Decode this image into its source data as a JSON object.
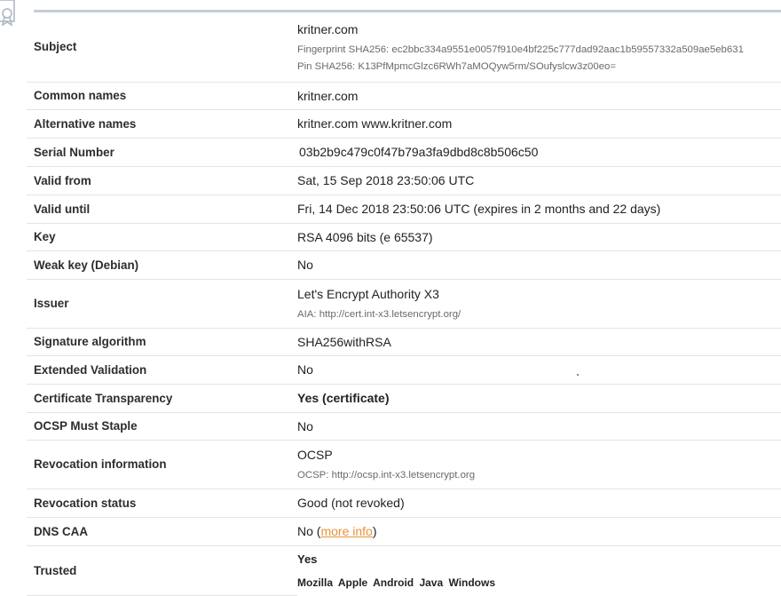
{
  "rows": [
    {
      "label": "Subject",
      "value": "kritner.com",
      "sub1": "Fingerprint SHA256: ec2bbc334a9551e0057f910e4bf225c777dad92aac1b59557332a509ae5eb631",
      "sub2": "Pin SHA256: K13PfMpmcGlzc6RWh7aMOQyw5rm/SOufyslcw3z00eo="
    },
    {
      "label": "Common names",
      "value": "kritner.com"
    },
    {
      "label": "Alternative names",
      "value": "kritner.com www.kritner.com"
    },
    {
      "label": "Serial Number",
      "value": "03b2b9c479c0f47b79a3fa9dbd8c8b506c50"
    },
    {
      "label": "Valid from",
      "value": "Sat, 15 Sep 2018 23:50:06 UTC"
    },
    {
      "label": "Valid until",
      "value": "Fri, 14 Dec 2018 23:50:06 UTC (expires in 2 months and 22 days)"
    },
    {
      "label": "Key",
      "value": "RSA 4096 bits (e 65537)"
    },
    {
      "label": "Weak key (Debian)",
      "value": "No"
    },
    {
      "label": "Issuer",
      "value": "Let's Encrypt Authority X3",
      "sub1": "AIA: http://cert.int-x3.letsencrypt.org/"
    },
    {
      "label": "Signature algorithm",
      "value": "SHA256withRSA"
    },
    {
      "label": "Extended Validation",
      "value": "No"
    },
    {
      "label": "Certificate Transparency",
      "value": "Yes (certificate)"
    },
    {
      "label": "OCSP Must Staple",
      "value": "No"
    },
    {
      "label": "Revocation information",
      "value": "OCSP",
      "sub1": "OCSP: http://ocsp.int-x3.letsencrypt.org"
    },
    {
      "label": "Revocation status",
      "value": "Good (not revoked)"
    },
    {
      "label": "DNS CAA",
      "value": "No",
      "link": "more info"
    },
    {
      "label": "Trusted",
      "value": "Yes",
      "list": "Mozilla Apple Android Java Windows"
    }
  ],
  "icon": "certificate-icon"
}
